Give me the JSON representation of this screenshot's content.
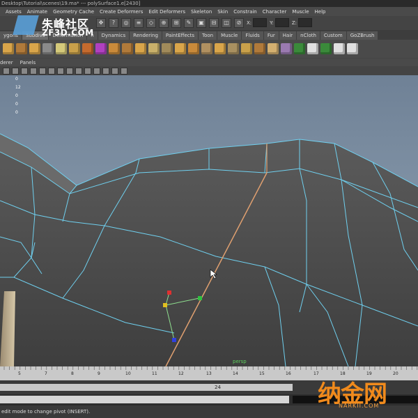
{
  "title_bar": {
    "text": "Desktop\\Tutorial\\scenes\\19.ma*  ---  polySurface1.e[2430]"
  },
  "menu": [
    "Assets",
    "Animate",
    "Geometry Cache",
    "Create Deformers",
    "Edit Deformers",
    "Skeleton",
    "Skin",
    "Constrain",
    "Character",
    "Muscle",
    "Help"
  ],
  "status_line": {
    "icons": [
      "move-icon",
      "question-icon"
    ],
    "coords": [
      {
        "label": "X:"
      },
      {
        "label": "Y:"
      },
      {
        "label": "Z:"
      }
    ]
  },
  "logo": {
    "cn": "朱峰社区",
    "en": "ZF3D.COM"
  },
  "shelf_tabs": [
    "ygons",
    "Subdivs",
    "Deformation",
    "n",
    "Dynamics",
    "Rendering",
    "PaintEffects",
    "Toon",
    "Muscle",
    "Fluids",
    "Fur",
    "Hair",
    "nCloth",
    "Custom",
    "GoZBrush"
  ],
  "shelf_tabs_active": 1,
  "shelf_icon_colors": [
    "#d9a54a",
    "#b07a3a",
    "#d9a54a",
    "#8a8a8a",
    "#d4c97a",
    "#c9a04a",
    "#c46a2e",
    "#b040c0",
    "#c98a3a",
    "#b07a3a",
    "#d9a54a",
    "#c9b06a",
    "#a08a5a",
    "#d9a54a",
    "#c98a3a",
    "#b09060",
    "#d9a54a",
    "#a89060",
    "#c9a04a",
    "#b07a3a",
    "#d4b070",
    "#9a7ab0",
    "#3a8a3a",
    "#e0e0e0",
    "#3a8a3a",
    "#e0e0e0",
    "#e0e0e0"
  ],
  "panel_menu": [
    "derer",
    "Panels"
  ],
  "hud_values": [
    "0",
    "12",
    "0",
    "0",
    "0"
  ],
  "camera_label": "persp",
  "time_ticks": [
    "5",
    "7",
    "8",
    "9",
    "10",
    "11",
    "12",
    "13",
    "14",
    "15",
    "16",
    "17",
    "18",
    "19",
    "20"
  ],
  "range_value": "24",
  "help_line": "edit mode to change pivot (INSERT).",
  "watermark": {
    "cn": "纳金网",
    "en": "NARKII.COM"
  }
}
